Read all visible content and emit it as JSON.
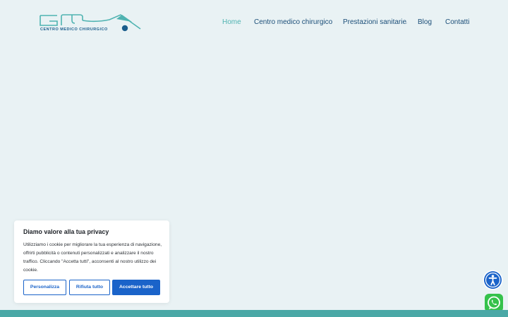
{
  "brand": {
    "logo_letters": "GMA",
    "tagline": "CENTRO MEDICO CHIRURGICO",
    "colors": {
      "teal": "#4fb3b1",
      "navy": "#1a5d8c"
    }
  },
  "nav": {
    "items": [
      {
        "label": "Home",
        "active": true
      },
      {
        "label": "Centro medico chirurgico",
        "active": false
      },
      {
        "label": "Prestazioni sanitarie",
        "active": false,
        "has_dropdown": true
      },
      {
        "label": "Blog",
        "active": false
      },
      {
        "label": "Contatti",
        "active": false
      }
    ],
    "dropdown_icon": "chevron-down-icon"
  },
  "cookie_banner": {
    "title": "Diamo valore alla tua privacy",
    "body": "Utilizziamo i cookie per migliorare la tua esperienza di navigazione, offrirti pubblicità o contenuti personalizzati e analizzare il nostro traffico. Cliccando \"Accetta tutti\", acconsenti al nostro utilizzo dei cookie.",
    "customize_label": "Personalizza",
    "reject_label": "Rifiuta tutto",
    "accept_label": "Accettare tutto",
    "accent_color": "#1a63c9"
  },
  "floating": {
    "accessibility_icon": "accessibility-icon",
    "whatsapp_icon": "whatsapp-icon"
  },
  "theme": {
    "page_background": "#e9f2f4",
    "footer_band": "#4aa8a6"
  }
}
